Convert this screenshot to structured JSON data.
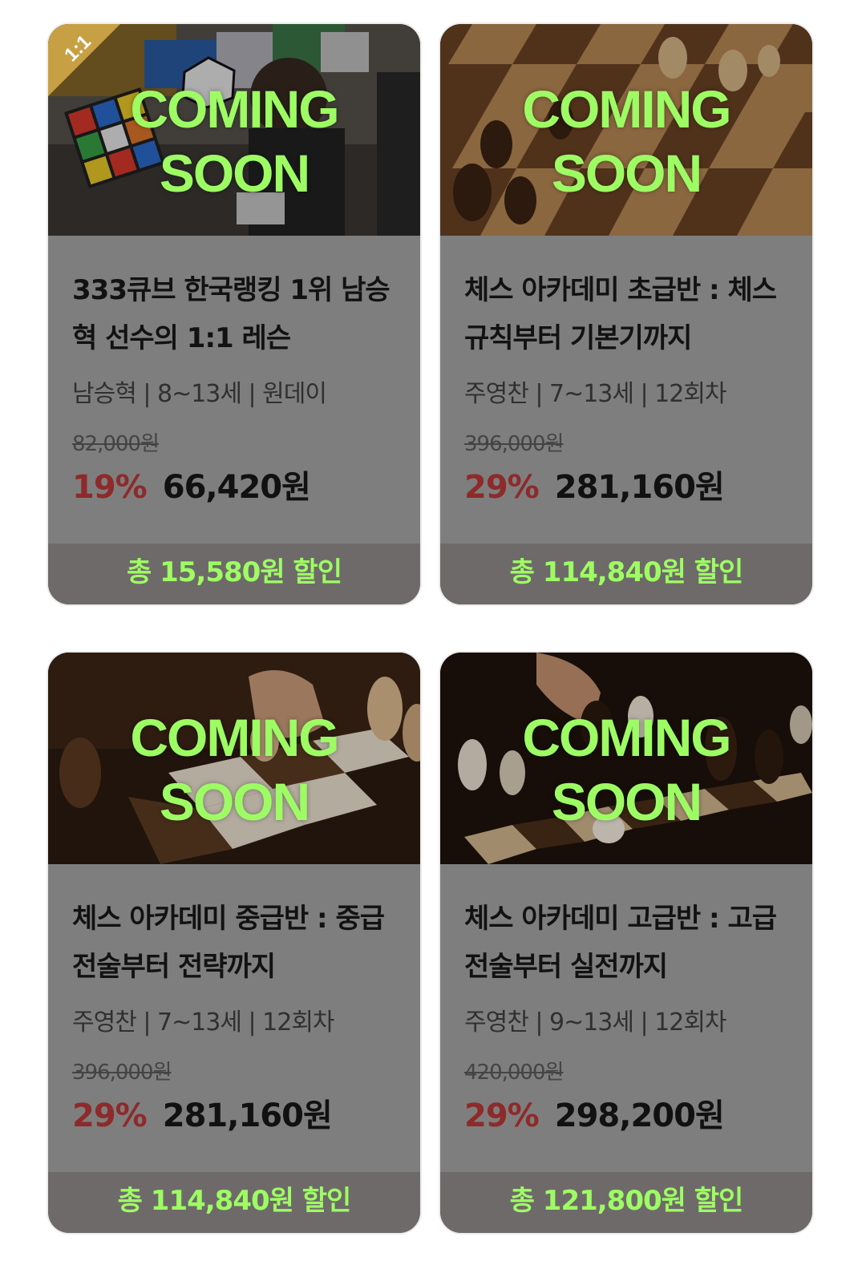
{
  "overlay": {
    "line1": "COMING",
    "line2": "SOON"
  },
  "cards": [
    {
      "thumb": "cube-player-photo",
      "badge": "1:1",
      "title": "333큐브 한국랭킹 1위 남승혁 선수의 1:1 레슨",
      "meta": "남승혁 | 8~13세 | 원데이",
      "original_price": "82,000원",
      "discount": "19%",
      "sale_price": "66,420원",
      "total_discount": "총 15,580원 할인"
    },
    {
      "thumb": "chess-board-photo",
      "title": "체스 아카데미 초급반 : 체스 규칙부터 기본기까지",
      "meta": "주영찬 | 7~13세 | 12회차",
      "original_price": "396,000원",
      "discount": "29%",
      "sale_price": "281,160원",
      "total_discount": "총 114,840원 할인"
    },
    {
      "thumb": "chess-hand-photo",
      "title": "체스 아카데미 중급반 : 중급 전술부터 전략까지",
      "meta": "주영찬 | 7~13세 | 12회차",
      "original_price": "396,000원",
      "discount": "29%",
      "sale_price": "281,160원",
      "total_discount": "총 114,840원 할인"
    },
    {
      "thumb": "chess-move-photo",
      "title": "체스 아카데미 고급반 : 고급 전술부터 실전까지",
      "meta": "주영찬 | 9~13세 | 12회차",
      "original_price": "420,000원",
      "discount": "29%",
      "sale_price": "298,200원",
      "total_discount": "총 121,800원 할인"
    }
  ]
}
